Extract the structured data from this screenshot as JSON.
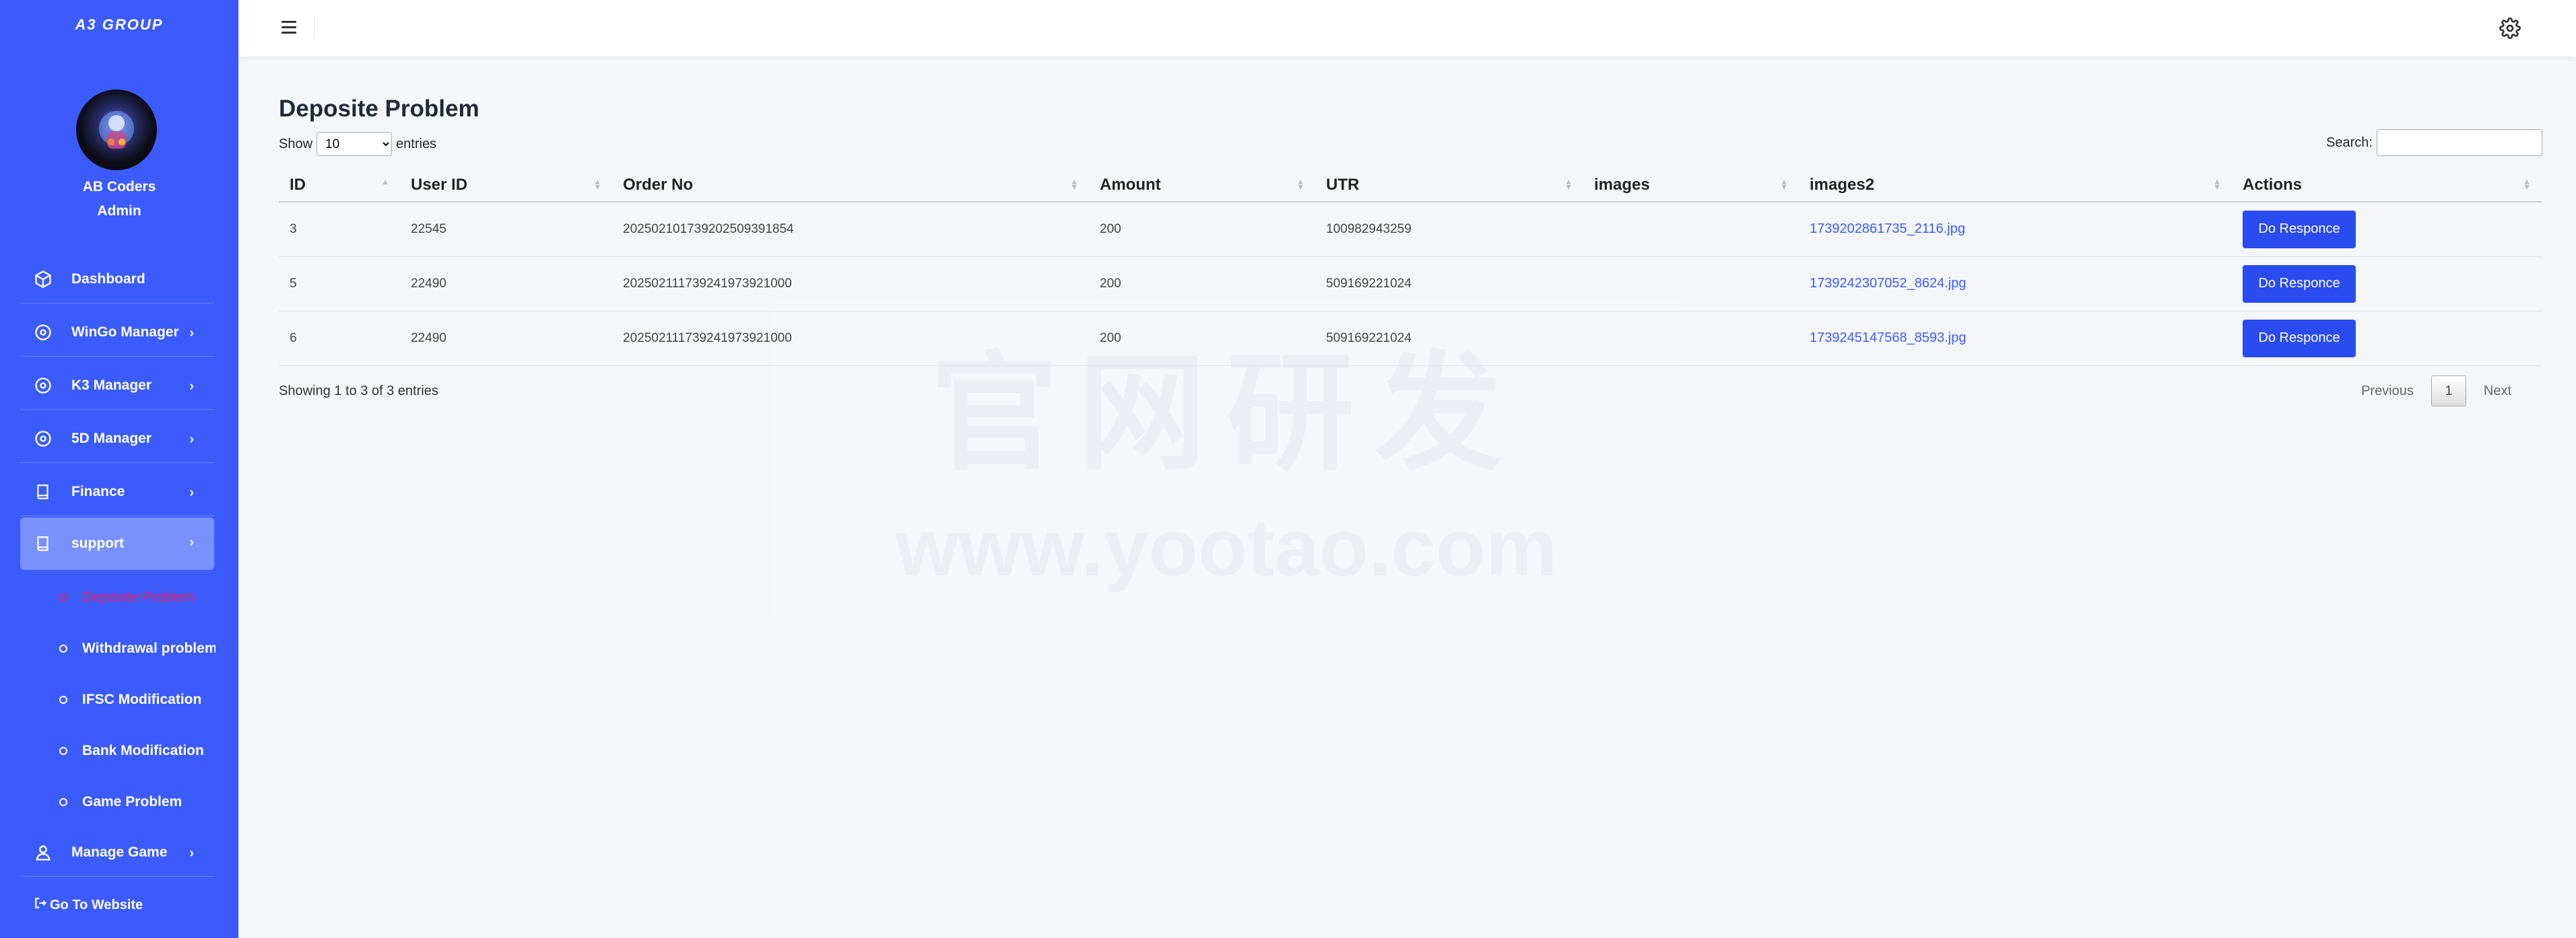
{
  "sidebar": {
    "brand": "A3 GROUP",
    "user": {
      "name": "AB Coders",
      "role": "Admin"
    },
    "items": [
      {
        "label": "Dashboard"
      },
      {
        "label": "WinGo Manager"
      },
      {
        "label": "K3 Manager"
      },
      {
        "label": "5D Manager"
      },
      {
        "label": "Finance"
      },
      {
        "label": "support"
      },
      {
        "label": "Manage Game"
      }
    ],
    "support_sub": [
      {
        "label": "Deposite Problem"
      },
      {
        "label": "Withdrawal problem"
      },
      {
        "label": "IFSC Modification"
      },
      {
        "label": "Bank Modification"
      },
      {
        "label": "Game Problem"
      }
    ],
    "goto": "Go To Website"
  },
  "page": {
    "title": "Deposite Problem",
    "show": "Show",
    "entries": "entries",
    "length_value": "10",
    "search_label": "Search:"
  },
  "table": {
    "headers": [
      "ID",
      "User ID",
      "Order No",
      "Amount",
      "UTR",
      "images",
      "images2",
      "Actions"
    ],
    "rows": [
      {
        "id": "3",
        "user_id": "22545",
        "order_no": "20250210173920250939​1854",
        "amount": "200",
        "utr": "100982943259",
        "images": "",
        "images2": "1739202861735_2116.jpg",
        "action": "Do Responce"
      },
      {
        "id": "5",
        "user_id": "22490",
        "order_no": "2025021117392419739​21000",
        "amount": "200",
        "utr": "509169221024",
        "images": "",
        "images2": "1739242307052_8624.jpg",
        "action": "Do Responce"
      },
      {
        "id": "6",
        "user_id": "22490",
        "order_no": "2025021117392419739​21000",
        "amount": "200",
        "utr": "509169221024",
        "images": "",
        "images2": "1739245147568_8593.jpg",
        "action": "Do Responce"
      }
    ]
  },
  "footer": {
    "info": "Showing 1 to 3 of 3 entries",
    "previous": "Previous",
    "page": "1",
    "next": "Next"
  },
  "watermark": {
    "line1": "官网研发",
    "line2": "www.yootao.com"
  },
  "colors": {
    "sidebar": "#3b5bfd",
    "active_sub": "#e91e63",
    "button": "#2a4bf0"
  }
}
